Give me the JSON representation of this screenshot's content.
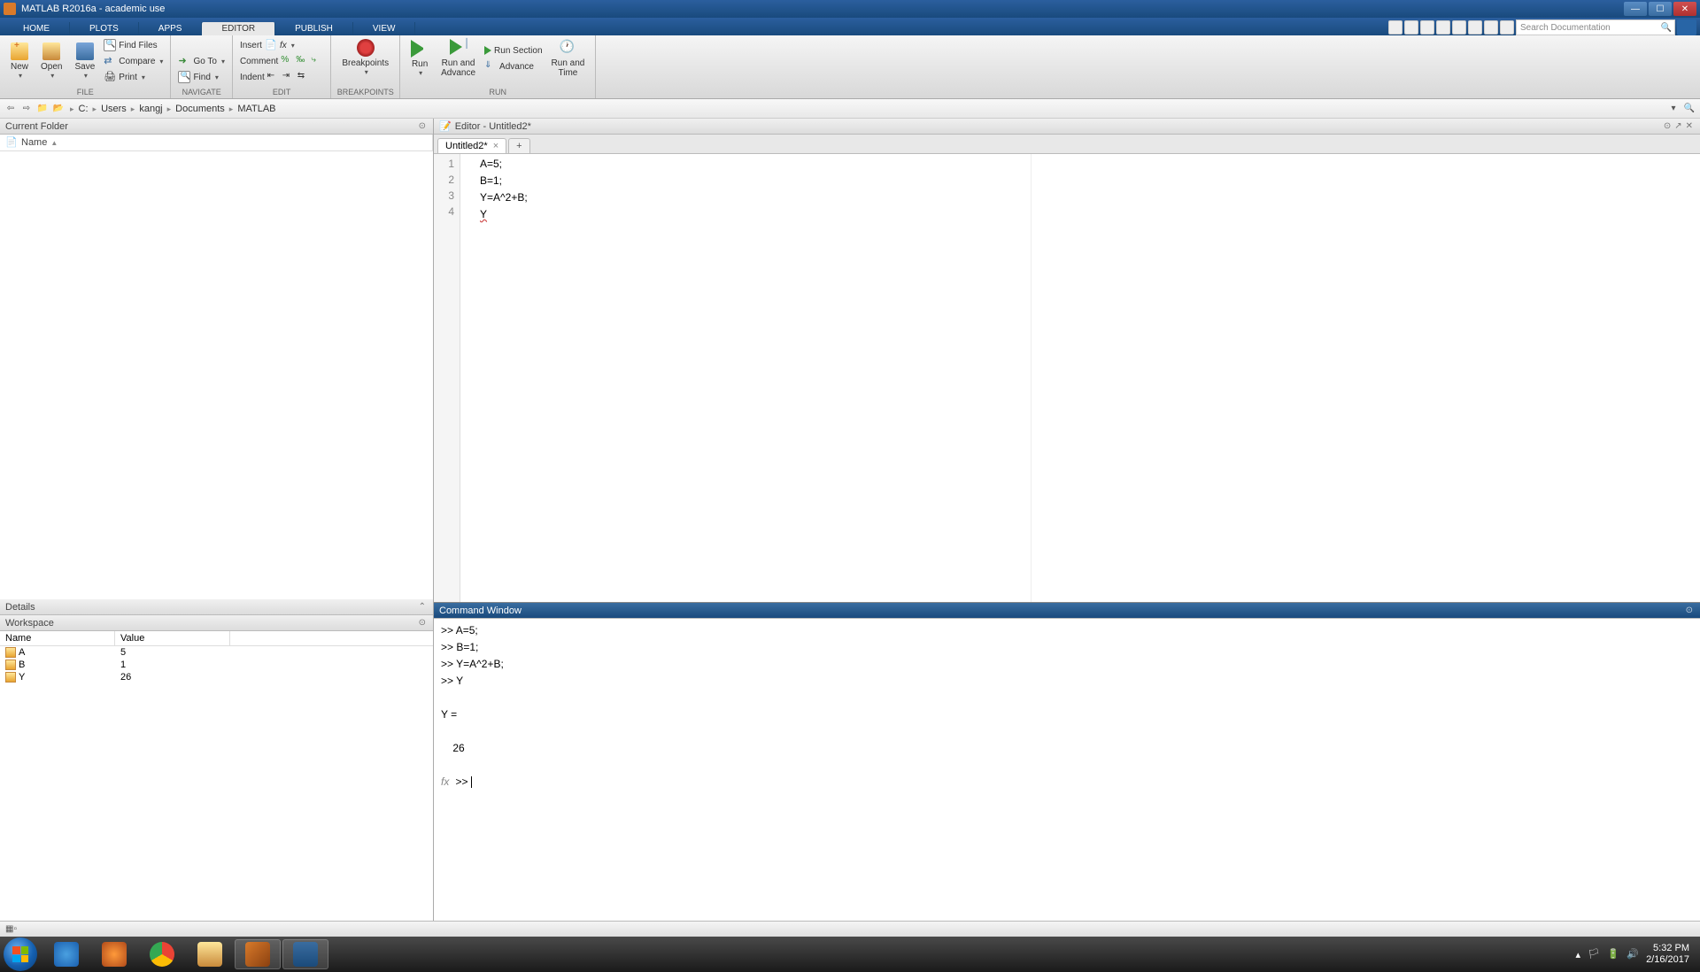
{
  "titlebar": {
    "title": "MATLAB R2016a - academic use"
  },
  "maintabs": {
    "home": "HOME",
    "plots": "PLOTS",
    "apps": "APPS",
    "editor": "EDITOR",
    "publish": "PUBLISH",
    "view": "VIEW"
  },
  "search": {
    "placeholder": "Search Documentation"
  },
  "ribbon": {
    "file": {
      "new": "New",
      "open": "Open",
      "save": "Save",
      "find_files": "Find Files",
      "compare": "Compare",
      "print": "Print",
      "label": "FILE"
    },
    "navigate": {
      "goto": "Go To",
      "find": "Find",
      "label": "NAVIGATE"
    },
    "edit": {
      "insert": "Insert",
      "comment": "Comment",
      "indent": "Indent",
      "label": "EDIT"
    },
    "breakpoints": {
      "breakpoints": "Breakpoints",
      "label": "BREAKPOINTS"
    },
    "run": {
      "run": "Run",
      "run_advance": "Run and\nAdvance",
      "run_section": "Run Section",
      "advance": "Advance",
      "run_time": "Run and\nTime",
      "label": "RUN"
    }
  },
  "breadcrumb": [
    "C:",
    "Users",
    "kangj",
    "Documents",
    "MATLAB"
  ],
  "panels": {
    "current_folder": "Current Folder",
    "details": "Details",
    "workspace": "Workspace",
    "editor": "Editor - Untitled2*",
    "command": "Command Window"
  },
  "current_folder": {
    "columns": [
      "Name"
    ]
  },
  "workspace": {
    "columns": [
      "Name",
      "Value"
    ],
    "rows": [
      {
        "name": "A",
        "value": "5"
      },
      {
        "name": "B",
        "value": "1"
      },
      {
        "name": "Y",
        "value": "26"
      }
    ]
  },
  "editor": {
    "tab": "Untitled2*",
    "lines": [
      "1",
      "2",
      "3",
      "4"
    ],
    "code": [
      "A=5;",
      "B=1;",
      "Y=A^2+B;",
      "Y"
    ]
  },
  "command": {
    "lines": [
      ">> A=5;",
      ">> B=1;",
      ">> Y=A^2+B;",
      ">> Y",
      "",
      "Y =",
      "",
      "    26",
      ""
    ],
    "prompt": ">> "
  },
  "tray": {
    "time": "5:32 PM",
    "date": "2/16/2017"
  }
}
